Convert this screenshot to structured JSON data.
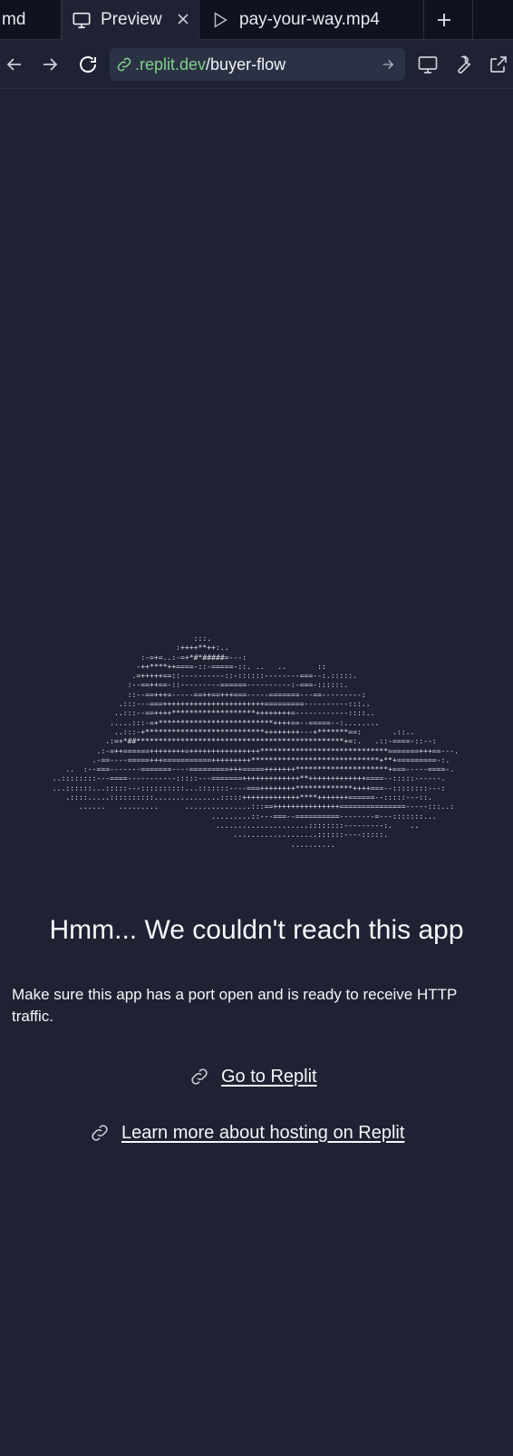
{
  "tabs": [
    {
      "label": "md",
      "icon": "none"
    },
    {
      "label": "Preview",
      "icon": "monitor-icon",
      "active": true
    },
    {
      "label": "pay-your-way.mp4",
      "icon": "play-icon"
    }
  ],
  "toolbar": {
    "url_domain": ".replit.dev",
    "url_path": "/buyer-flow"
  },
  "error": {
    "ascii_art": "                                  :::.\n                              :++++**++:..\n                      :-=+=..:-=+*#*#####=---:\n                     -++****++====-::-=====-::. ..   ..       ::\n                    .=+++++==::----------::-::::::--------===--:.:::::.\n                   :--==++==-::---------======----------:-===-::::::.\n                   ::--==+++=-----==++==+++===-----=======---==---------:\n                 .:::---===+++++++++++++++++++++++=========----------:::..\n                ..:::--==++++*******************++++++++=------------::::..\n               .....:::-=+**************************++++==--=====--:........\n                ..:::-+***************************++++++++---+*******==:       .::..\n              .:=+*##***********************************************+=:.   .::-====-::--:\n            .:-=++======++++++++=++++++++++++++++*****************************=======+++==---.\n           .-==----=====+++===========+++++++++*****************************+**+=========-:.\n     ..  :--===-------=======----=========+++=====+++++++*********************+===-----====-.\n  ..::::::::---====-----------:::::---=======+++++++++++++**+++++++++++++====--:::::------.\n  ...::::::...:::::---::::::::::...:::::::----===++++++++*************++++===--::::::::---:\n     .::::.....::::::::::...............:::::+++++++++++++****+++++++======--:::::---::.\n        ......   .........      ...............:::==+++++++++++++++===============-----:::..:\n                                      .........::---===--==========--------=---:::::::...\n                                       .....................::::::::---------:.    ..\n                                           ...................::::::----:::::.\n                                                        ..........",
    "heading": "Hmm... We couldn't reach this app",
    "message": "Make sure this app has a port open and is ready to receive HTTP traffic.",
    "links": [
      {
        "label": "Go to Replit",
        "icon": "link-icon"
      },
      {
        "label": "Learn more about hosting on Replit",
        "icon": "link-icon"
      }
    ]
  },
  "colors": {
    "background": "#1e2232",
    "tabbar": "#0f1320",
    "urlbar": "#2c3245",
    "domain_green": "#7fd18b",
    "text": "#f5f7fa"
  }
}
